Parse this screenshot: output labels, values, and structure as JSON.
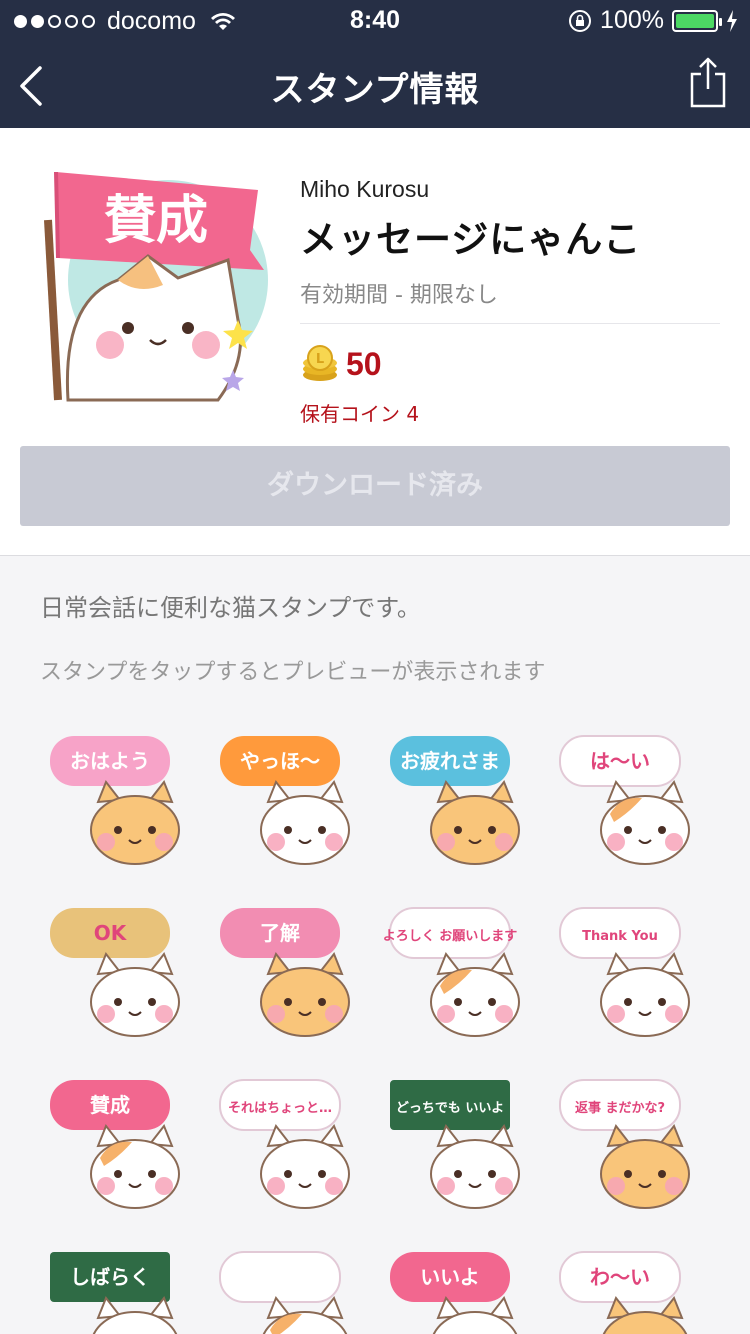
{
  "status_bar": {
    "carrier": "docomo",
    "time": "8:40",
    "battery": "100%"
  },
  "nav": {
    "title": "スタンプ情報"
  },
  "package": {
    "author": "Miho Kurosu",
    "title": "メッセージにゃんこ",
    "validity": "有効期間 - 期限なし",
    "price": "50",
    "owned_coins": "保有コイン 4",
    "download_label": "ダウンロード済み",
    "main_sticker_text": "賛成"
  },
  "description": "日常会話に便利な猫スタンプです。",
  "hint": "スタンプをタップするとプレビューが表示されます",
  "stickers": [
    {
      "text": "おはよう",
      "cat": "orange",
      "bubble": "#f7a3c8"
    },
    {
      "text": "やっほ〜",
      "cat": "pair",
      "bubble": "#ff9a3c"
    },
    {
      "text": "お疲れさま",
      "cat": "orange",
      "bubble": "#5bc0de"
    },
    {
      "text": "は〜い",
      "cat": "calico",
      "bubble": "#ffffff"
    },
    {
      "text": "OK",
      "cat": "white",
      "bubble": "#e8c27a"
    },
    {
      "text": "了解",
      "cat": "orange",
      "bubble": "#f28db2"
    },
    {
      "text": "よろしく お願いします",
      "cat": "calico",
      "bubble": "#ffffff"
    },
    {
      "text": "Thank You",
      "cat": "white",
      "bubble": "#ffffff"
    },
    {
      "text": "賛成",
      "cat": "calico",
      "bubble": "#f2678f"
    },
    {
      "text": "それはちょっと…",
      "cat": "white",
      "bubble": "#ffffff"
    },
    {
      "text": "どっちでも いいよ",
      "cat": "white",
      "bubble": "#2f6b45"
    },
    {
      "text": "返事 まだかな?",
      "cat": "orange",
      "bubble": "#ffffff"
    },
    {
      "text": "しばらく",
      "cat": "white",
      "bubble": "#2f6b45"
    },
    {
      "text": "",
      "cat": "calico",
      "bubble": "#ffffff"
    },
    {
      "text": "いいよ",
      "cat": "white",
      "bubble": "#f2678f"
    },
    {
      "text": "わ〜い",
      "cat": "orange",
      "bubble": "#ffffff"
    }
  ],
  "colors": {
    "nav_bg": "#262f45",
    "accent_red": "#b5121b",
    "download_disabled": "#c8cad4",
    "battery_green": "#4cd964"
  }
}
